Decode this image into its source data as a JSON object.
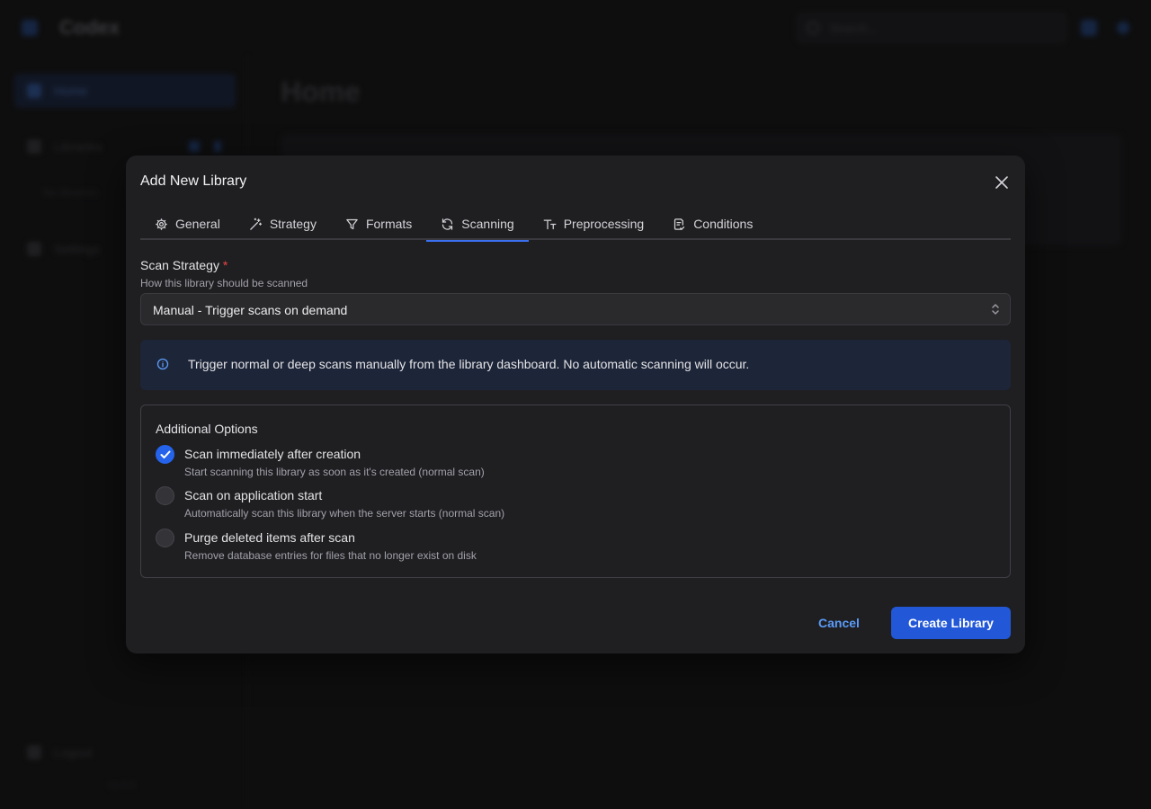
{
  "background": {
    "app_title": "Codex",
    "search_placeholder": "Search...",
    "page_title": "Home",
    "sidebar": {
      "home": "Home",
      "libraries": "Libraries",
      "no_libraries": "No libraries",
      "settings": "Settings",
      "logout": "Logout",
      "version": "v1.0.0"
    }
  },
  "modal": {
    "title": "Add New Library",
    "tabs": [
      {
        "label": "General",
        "icon": "gear-icon"
      },
      {
        "label": "Strategy",
        "icon": "magic-wand-icon"
      },
      {
        "label": "Formats",
        "icon": "filter-icon"
      },
      {
        "label": "Scanning",
        "icon": "refresh-icon",
        "active": true
      },
      {
        "label": "Preprocessing",
        "icon": "text-format-icon"
      },
      {
        "label": "Conditions",
        "icon": "document-check-icon"
      }
    ],
    "scan_strategy": {
      "label": "Scan Strategy",
      "required_mark": "*",
      "description": "How this library should be scanned",
      "value": "Manual - Trigger scans on demand"
    },
    "info_alert": "Trigger normal or deep scans manually from the library dashboard. No automatic scanning will occur.",
    "additional_options": {
      "title": "Additional Options",
      "items": [
        {
          "label": "Scan immediately after creation",
          "description": "Start scanning this library as soon as it's created (normal scan)",
          "checked": true
        },
        {
          "label": "Scan on application start",
          "description": "Automatically scan this library when the server starts (normal scan)",
          "checked": false
        },
        {
          "label": "Purge deleted items after scan",
          "description": "Remove database entries for files that no longer exist on disk",
          "checked": false
        }
      ]
    },
    "cancel_label": "Cancel",
    "create_label": "Create Library"
  },
  "colors": {
    "accent": "#2563eb",
    "link": "#5b9bf8",
    "required": "#f04444",
    "alert_bg": "#1d2538"
  }
}
